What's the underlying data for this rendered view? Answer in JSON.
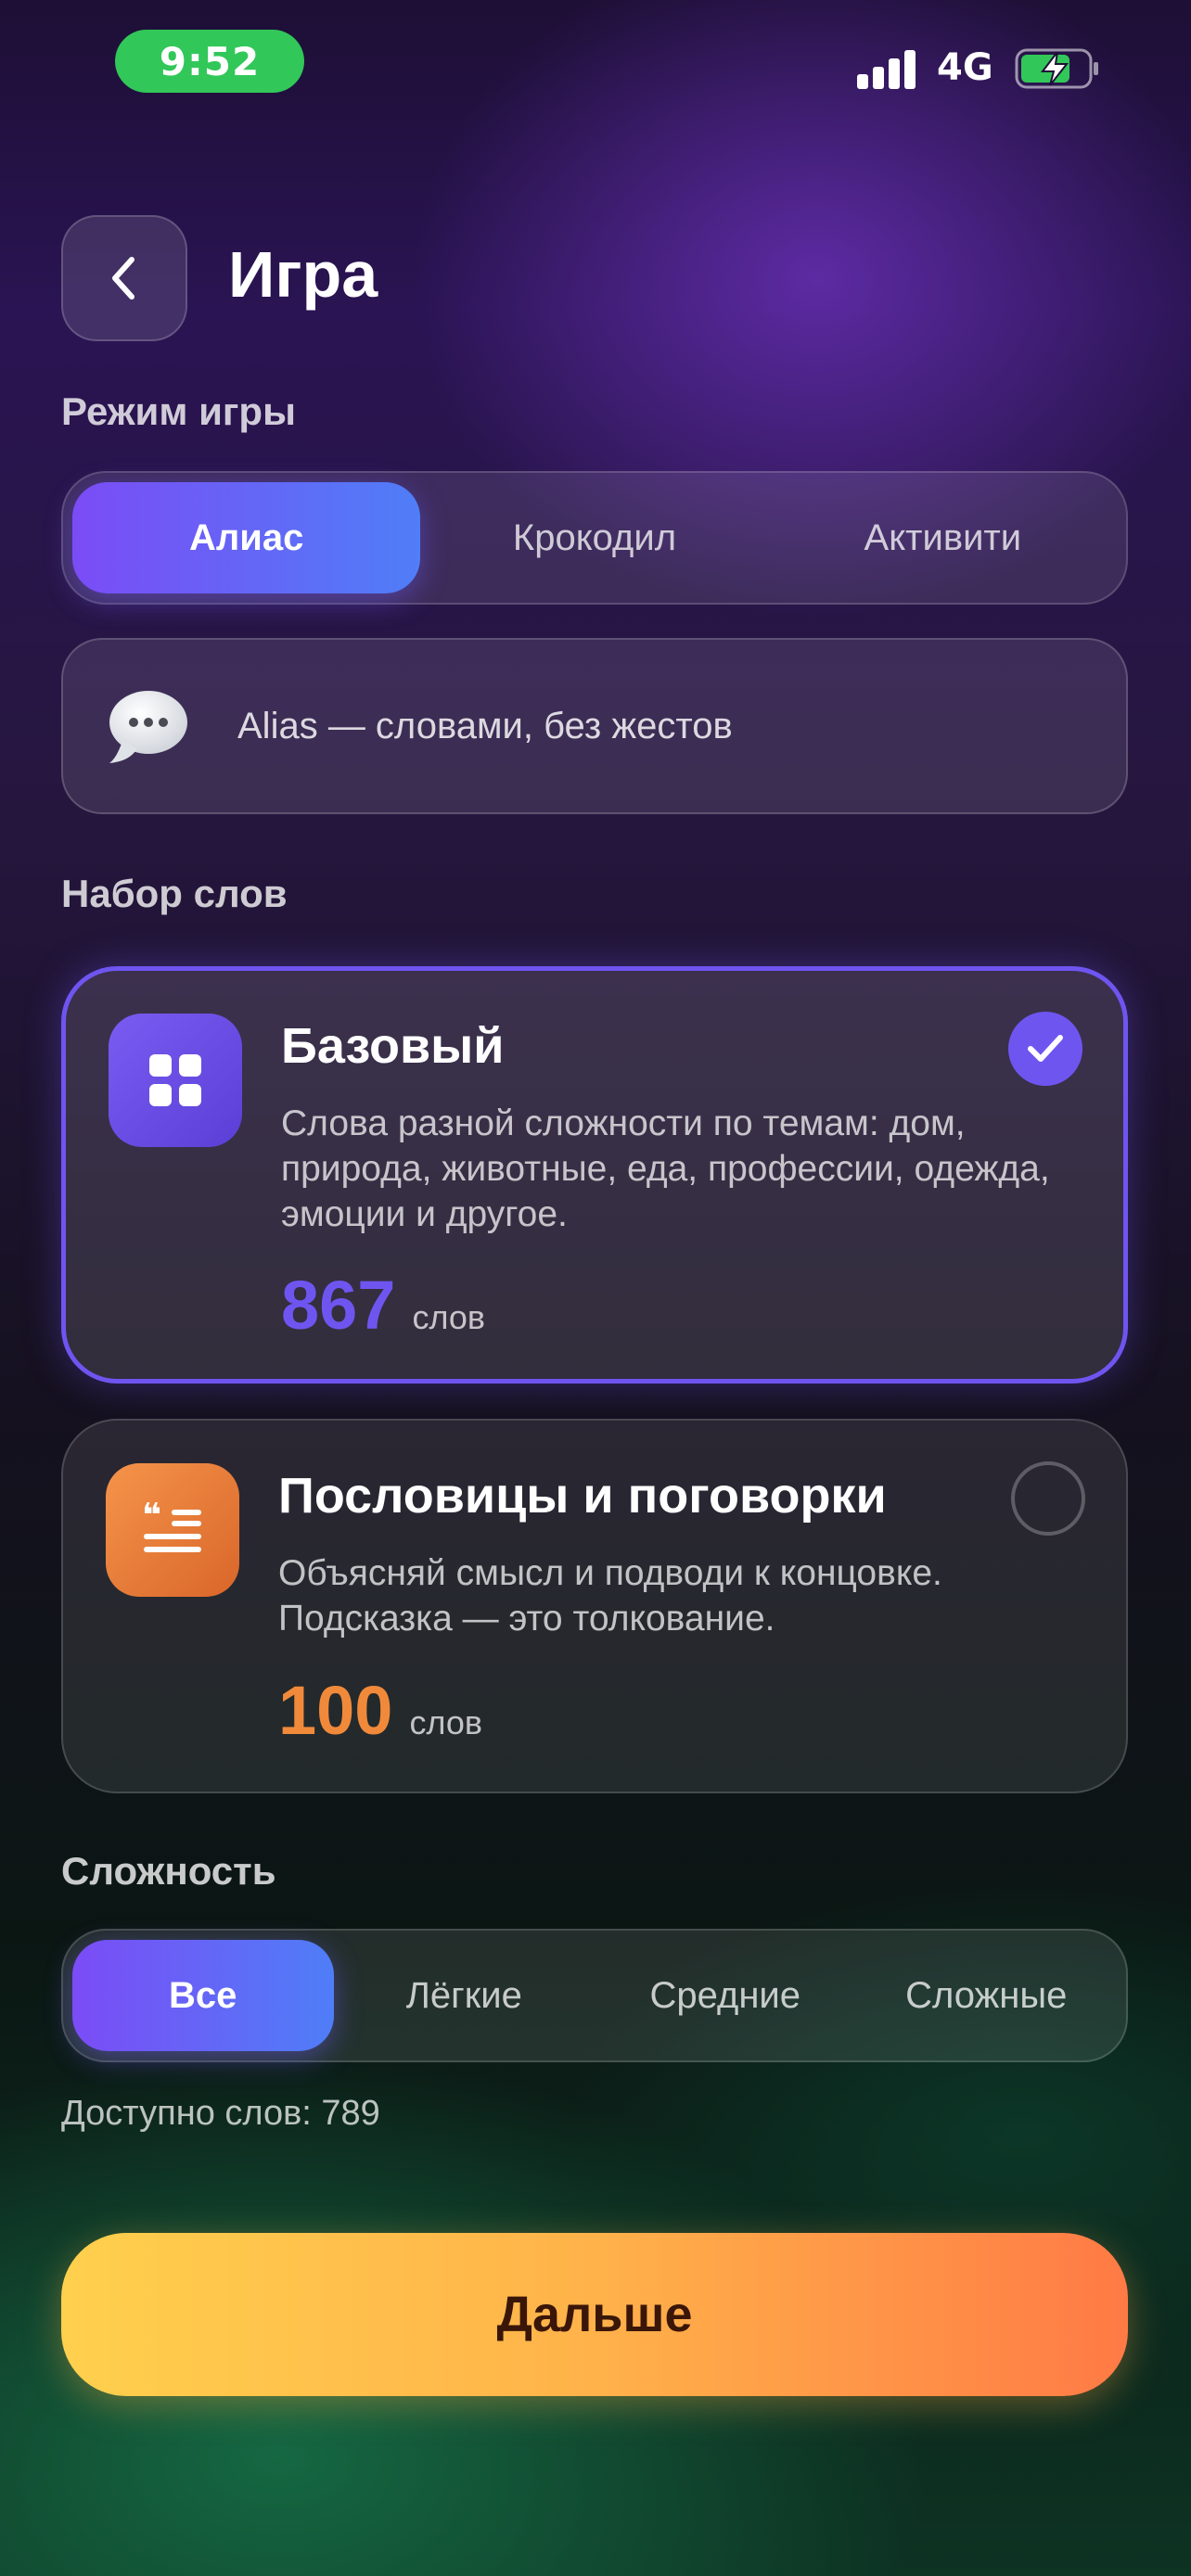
{
  "status_bar": {
    "time": "9:52",
    "network": "4G"
  },
  "header": {
    "title": "Игра"
  },
  "mode": {
    "label": "Режим игры",
    "tabs": [
      "Алиас",
      "Крокодил",
      "Активити"
    ],
    "selected": "Алиас"
  },
  "info": {
    "icon": "speech-bubble-icon",
    "text": "Alias — словами, без жестов"
  },
  "packs": {
    "label": "Набор слов",
    "items": [
      {
        "title": "Базовый",
        "description": "Слова разной сложности по темам: дом, природа, животные, еда, профессии, одежда, эмоции и другое.",
        "count": "867",
        "unit": "слов",
        "selected": true,
        "icon": "grid-icon",
        "accent": "#6f55f0"
      },
      {
        "title": "Пословицы и поговорки",
        "description": "Объясняй смысл и подводи к концовке. Подсказка — это толкование.",
        "count": "100",
        "unit": "слов",
        "selected": false,
        "icon": "quote-list-icon",
        "accent": "#f08a3a"
      }
    ]
  },
  "difficulty": {
    "label": "Сложность",
    "tabs": [
      "Все",
      "Лёгкие",
      "Средние",
      "Сложные"
    ],
    "selected": "Все"
  },
  "available": "Доступно слов: 789",
  "next_button": "Дальше",
  "colors": {
    "primary": "#6f55f0",
    "orange": "#f08a3a",
    "success": "#32c759",
    "cta_start": "#ffd04d",
    "cta_end": "#ff7a45"
  }
}
